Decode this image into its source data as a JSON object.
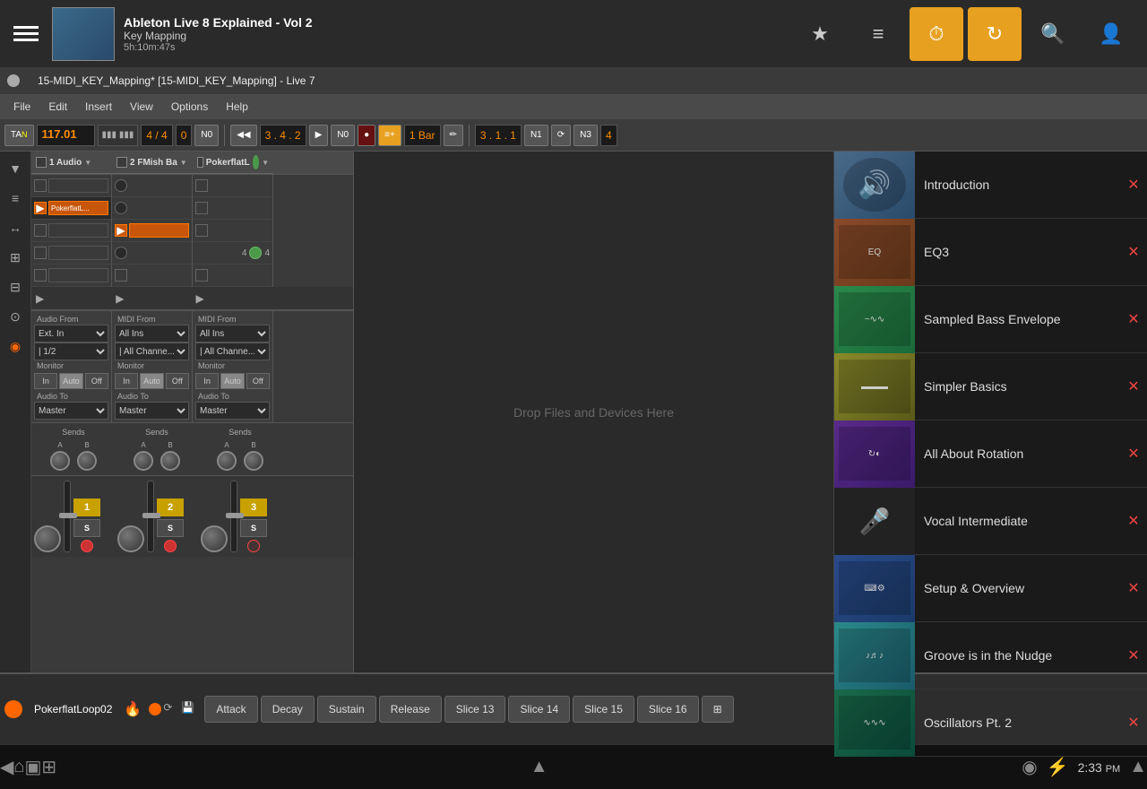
{
  "topbar": {
    "app_title": "Ableton Live 8 Explained - Vol 2",
    "sub_title": "Key Mapping",
    "time": "5h:10m:47s"
  },
  "window": {
    "title": "15-MIDI_KEY_Mapping* [15-MIDI_KEY_Mapping] - Live 7"
  },
  "menu": {
    "items": [
      "File",
      "Edit",
      "Insert",
      "View",
      "Options",
      "Help"
    ]
  },
  "transport": {
    "tempo": "117.01",
    "time_sig": "4 / 4",
    "pos": "0",
    "mode": "N0",
    "bar_display": "1 Bar",
    "position": "3 . 1 . 1",
    "measure": "3 . 4 . 2",
    "n1": "N1",
    "n3": "N3",
    "val4": "4",
    "val9": "4"
  },
  "tracks": {
    "columns": [
      {
        "name": "1 Audio",
        "type": "audio"
      },
      {
        "name": "2 FMish Ba",
        "type": "midi"
      },
      {
        "name": "PokerflatL",
        "type": "midi"
      }
    ]
  },
  "routing": {
    "audio_from": "Audio From",
    "midi_from1": "MIDI From",
    "midi_from2": "MIDI From",
    "ext_in": "Ext. In",
    "all_ins": "All Ins",
    "ch_1_2": "| 1/2",
    "all_channels": "| All Channe...",
    "monitor_label": "Monitor",
    "audio_to_label": "Audio To",
    "master": "Master",
    "sends_label": "Sends"
  },
  "channel_numbers": [
    "1",
    "2",
    "3"
  ],
  "bottom_instrument": {
    "name": "PokerflatLoop02",
    "tabs": [
      "Attack",
      "Decay",
      "Sustain",
      "Release",
      "Slice 13",
      "Slice 14",
      "Slice 15",
      "Slice 16"
    ]
  },
  "drop_zone": {
    "text": "Drop Files and Devices Here"
  },
  "lessons": [
    {
      "id": "intro",
      "title": "Introduction",
      "thumb_class": "lt-intro"
    },
    {
      "id": "eq3",
      "title": "EQ3",
      "thumb_class": "lt-eq3"
    },
    {
      "id": "sbe",
      "title": "Sampled Bass Envelope",
      "thumb_class": "lt-sbe"
    },
    {
      "id": "simpler",
      "title": "Simpler Basics",
      "thumb_class": "lt-simpler"
    },
    {
      "id": "rotation",
      "title": "All About Rotation",
      "thumb_class": "lt-rotation"
    },
    {
      "id": "vocal",
      "title": "Vocal Intermediate",
      "thumb_class": "lt-vocal"
    },
    {
      "id": "setup",
      "title": "Setup & Overview",
      "thumb_class": "lt-setup"
    },
    {
      "id": "groove",
      "title": "Groove is in the Nudge",
      "thumb_class": "lt-groove"
    },
    {
      "id": "osc",
      "title": "Oscillators Pt. 2",
      "thumb_class": "lt-osc"
    }
  ],
  "navbar": {
    "time": "2:33",
    "am_pm": "PM"
  },
  "icons": {
    "star": "★",
    "list": "≡",
    "clock": "⏱",
    "refresh": "↻",
    "search": "🔍",
    "user": "👤",
    "back": "◀",
    "home": "⌂",
    "square": "▣",
    "multi": "⊞",
    "android": "◉",
    "usb": "⚡",
    "wifi": "▲",
    "close": "✕",
    "fire": "🔥",
    "droplet": "💧"
  }
}
